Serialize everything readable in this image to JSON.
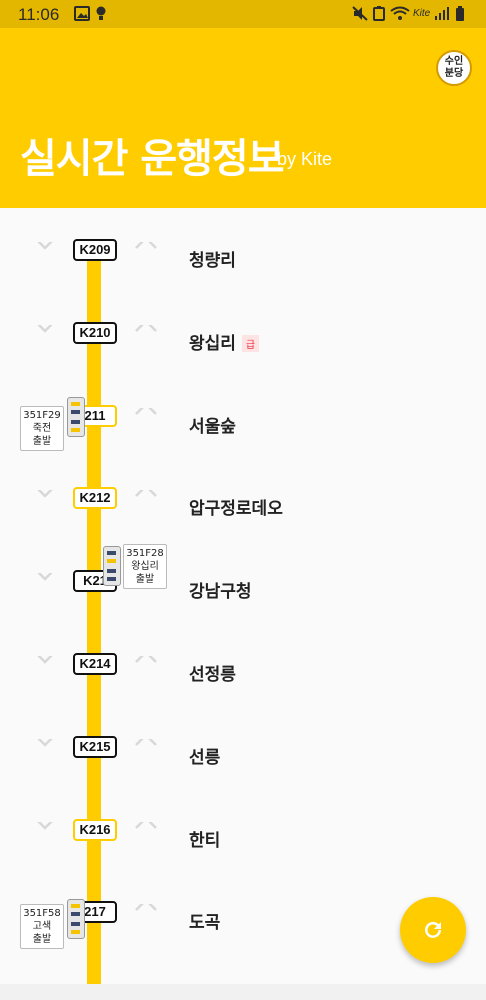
{
  "status": {
    "time": "11:06",
    "carrier": "Kite"
  },
  "header": {
    "title": "실시간 운행정보",
    "byline": "by Kite",
    "badge_line1": "수인",
    "badge_line2": "분당"
  },
  "stations": [
    {
      "code": "K209",
      "name": "청량리",
      "tag": ""
    },
    {
      "code": "K210",
      "name": "왕십리",
      "tag": "급"
    },
    {
      "code": "K211",
      "name": "서울숲",
      "tag": ""
    },
    {
      "code": "K212",
      "name": "압구정로데오",
      "tag": ""
    },
    {
      "code": "K213",
      "name": "강남구청",
      "tag": ""
    },
    {
      "code": "K214",
      "name": "선정릉",
      "tag": ""
    },
    {
      "code": "K215",
      "name": "선릉",
      "tag": ""
    },
    {
      "code": "K216",
      "name": "한티",
      "tag": ""
    },
    {
      "code": "K217",
      "name": "도곡",
      "tag": ""
    }
  ],
  "visible_codes": [
    "K209",
    "K210",
    "211",
    "K212",
    "K21",
    "K214",
    "K215",
    "K216",
    "217"
  ],
  "trains": [
    {
      "id": "351F29",
      "from": "죽전",
      "status": "출발"
    },
    {
      "id": "351F28",
      "from": "왕십리",
      "status": "출발"
    },
    {
      "id": "351F58",
      "from": "고색",
      "status": "출발"
    }
  ],
  "colors": {
    "accent": "#ffcc00",
    "track": "#ffcc00",
    "statusbar": "#e3b700"
  },
  "icons": {
    "refresh": "refresh-icon",
    "down": "chevron-down-icon",
    "up": "chevron-up-icon"
  }
}
